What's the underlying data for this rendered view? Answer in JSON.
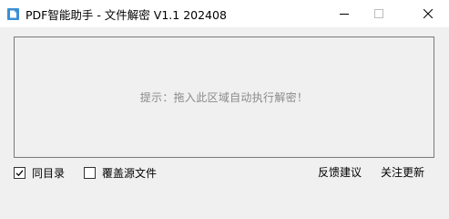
{
  "window": {
    "title": "PDF智能助手 - 文件解密 V1.1 202408",
    "app_icon": "document-app-icon",
    "controls": {
      "minimize_icon": "minimize-icon",
      "maximize_icon": "maximize-icon",
      "close_icon": "close-icon"
    }
  },
  "drop_area": {
    "hint": "提示：拖入此区域自动执行解密！"
  },
  "options": [
    {
      "label": "同目录",
      "checked": true
    },
    {
      "label": "覆盖源文件",
      "checked": false
    }
  ],
  "links": {
    "feedback": "反馈建议",
    "follow": "关注更新"
  },
  "colors": {
    "title_bar": "#ffffff",
    "window_bg": "#f0f0f0",
    "app_icon": "#3b8fd6",
    "hint_text": "#8a8a8a"
  }
}
